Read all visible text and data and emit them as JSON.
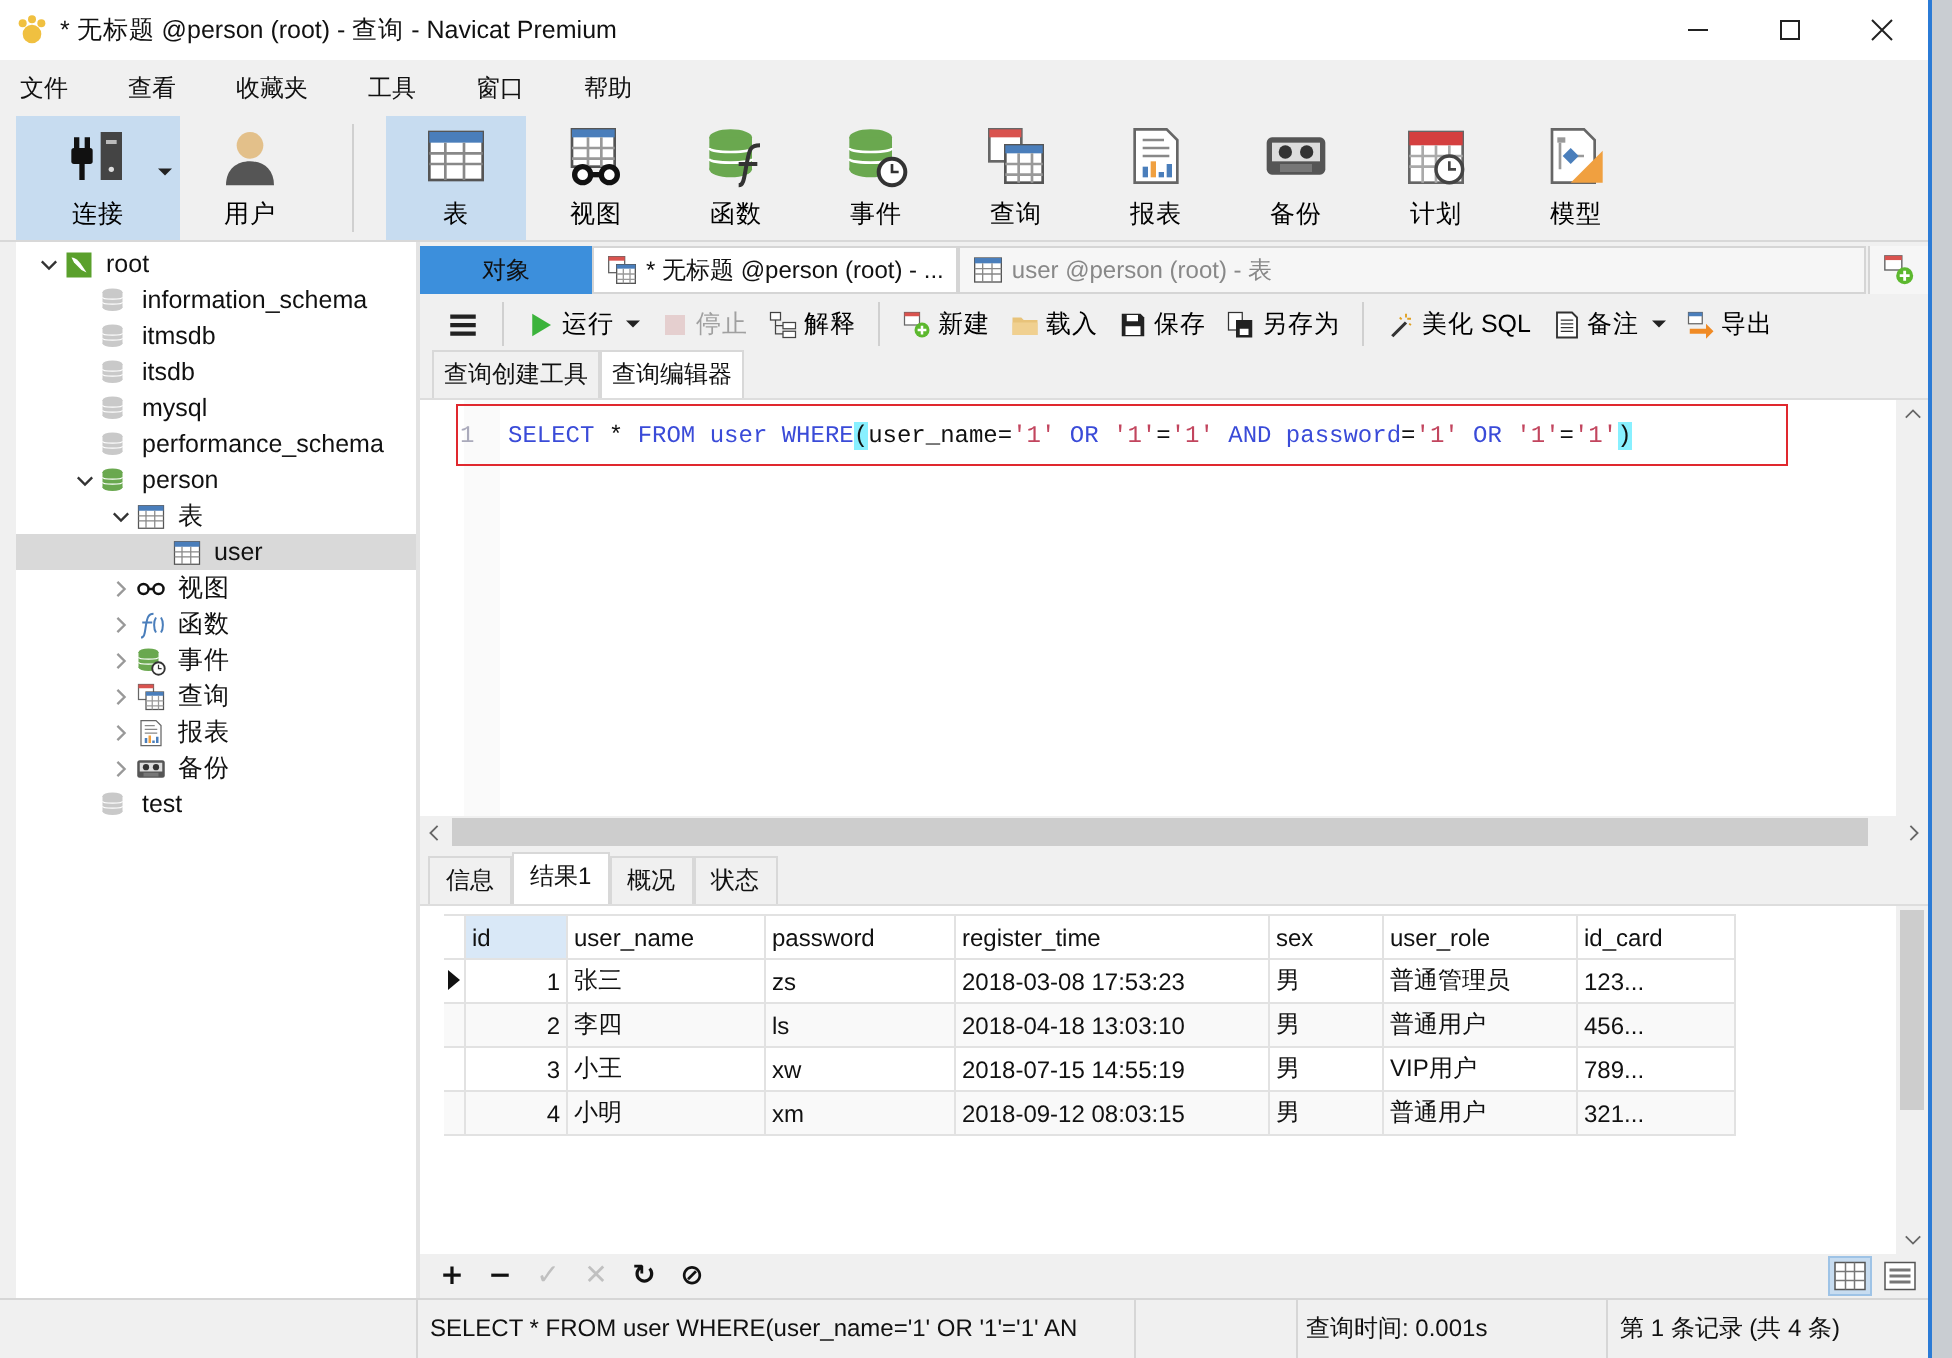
{
  "window": {
    "title": "* 无标题 @person (root) - 查询 - Navicat Premium"
  },
  "menu": [
    "文件",
    "查看",
    "收藏夹",
    "工具",
    "窗口",
    "帮助"
  ],
  "toolbar": [
    [
      {
        "label": "连接",
        "selected": true,
        "dropdown": true
      },
      {
        "label": "用户",
        "selected": false,
        "dropdown": false
      }
    ],
    [
      {
        "label": "表",
        "selected": true,
        "dropdown": false
      },
      {
        "label": "视图",
        "selected": false,
        "dropdown": false
      },
      {
        "label": "函数",
        "selected": false,
        "dropdown": false
      },
      {
        "label": "事件",
        "selected": false,
        "dropdown": false
      },
      {
        "label": "查询",
        "selected": false,
        "dropdown": false
      },
      {
        "label": "报表",
        "selected": false,
        "dropdown": false
      },
      {
        "label": "备份",
        "selected": false,
        "dropdown": false
      },
      {
        "label": "计划",
        "selected": false,
        "dropdown": false
      },
      {
        "label": "模型",
        "selected": false,
        "dropdown": false
      }
    ]
  ],
  "tree": [
    {
      "label": "root",
      "kind": "server",
      "expanded": true,
      "selected": false,
      "children": [
        {
          "label": "information_schema",
          "kind": "database",
          "selected": false
        },
        {
          "label": "itmsdb",
          "kind": "database",
          "selected": false
        },
        {
          "label": "itsdb",
          "kind": "database",
          "selected": false
        },
        {
          "label": "mysql",
          "kind": "database",
          "selected": false
        },
        {
          "label": "performance_schema",
          "kind": "database",
          "selected": false
        },
        {
          "label": "person",
          "kind": "database",
          "expanded": true,
          "selected": false,
          "children": [
            {
              "label": "表",
              "kind": "tables",
              "expanded": true,
              "selected": false,
              "children": [
                {
                  "label": "user",
                  "kind": "table",
                  "selected": true
                }
              ]
            },
            {
              "label": "视图",
              "kind": "views",
              "expanded": false,
              "selected": false
            },
            {
              "label": "函数",
              "kind": "functions",
              "expanded": false,
              "selected": false
            },
            {
              "label": "事件",
              "kind": "events",
              "expanded": false,
              "selected": false
            },
            {
              "label": "查询",
              "kind": "queries",
              "expanded": false,
              "selected": false
            },
            {
              "label": "报表",
              "kind": "reports",
              "expanded": false,
              "selected": false
            },
            {
              "label": "备份",
              "kind": "backups",
              "expanded": false,
              "selected": false
            }
          ]
        },
        {
          "label": "test",
          "kind": "database",
          "selected": false
        }
      ]
    }
  ],
  "editor_tabs": [
    {
      "label": "对象",
      "kind": "object",
      "selected": false
    },
    {
      "label": "* 无标题 @person (root) - ...",
      "kind": "query",
      "selected": true
    },
    {
      "label": "user @person (root) - 表",
      "kind": "table",
      "selected": false
    }
  ],
  "query_toolbar": [
    [
      {
        "disabled": false,
        "dropdown": false
      }
    ],
    [
      {
        "label": "运行",
        "disabled": false,
        "dropdown": true
      },
      {
        "label": "停止",
        "disabled": true,
        "dropdown": false
      },
      {
        "label": "解释",
        "disabled": false,
        "dropdown": false
      }
    ],
    [
      {
        "label": "新建",
        "disabled": false,
        "dropdown": false
      },
      {
        "label": "载入",
        "disabled": false,
        "dropdown": false
      },
      {
        "label": "保存",
        "disabled": false,
        "dropdown": false
      },
      {
        "label": "另存为",
        "disabled": false,
        "dropdown": false
      }
    ],
    [
      {
        "label": "美化 SQL",
        "disabled": false,
        "dropdown": false
      },
      {
        "label": "备注",
        "disabled": false,
        "dropdown": true
      },
      {
        "label": "导出",
        "disabled": false,
        "dropdown": false
      }
    ]
  ],
  "sub_tabs": [
    {
      "label": "查询创建工具",
      "selected": false
    },
    {
      "label": "查询编辑器",
      "selected": true
    }
  ],
  "sql": {
    "line_number": "1",
    "tokens": [
      {
        "text": "SELECT",
        "kind": "keyword"
      },
      {
        "text": " * ",
        "kind": "plain"
      },
      {
        "text": "FROM user WHERE",
        "kind": "keyword"
      },
      {
        "text": "(",
        "kind": "bracket"
      },
      {
        "text": "user_name=",
        "kind": "plain"
      },
      {
        "text": "'1'",
        "kind": "string"
      },
      {
        "text": " OR",
        "kind": "keyword"
      },
      {
        "text": " '1'",
        "kind": "string"
      },
      {
        "text": "=",
        "kind": "plain"
      },
      {
        "text": "'1'",
        "kind": "string"
      },
      {
        "text": " AND password",
        "kind": "keyword"
      },
      {
        "text": "=",
        "kind": "plain"
      },
      {
        "text": "'1'",
        "kind": "string"
      },
      {
        "text": " OR",
        "kind": "keyword"
      },
      {
        "text": " '1'",
        "kind": "string"
      },
      {
        "text": "=",
        "kind": "plain"
      },
      {
        "text": "'1'",
        "kind": "string"
      },
      {
        "text": ")",
        "kind": "bracket"
      }
    ]
  },
  "result_tabs": [
    {
      "label": "信息",
      "selected": false
    },
    {
      "label": "结果1",
      "selected": true
    },
    {
      "label": "概况",
      "selected": false
    },
    {
      "label": "状态",
      "selected": false
    }
  ],
  "grid": {
    "columns": [
      {
        "label": "id",
        "selected": true
      },
      {
        "label": "user_name",
        "selected": false
      },
      {
        "label": "password",
        "selected": false
      },
      {
        "label": "register_time",
        "selected": false
      },
      {
        "label": "sex",
        "selected": false
      },
      {
        "label": "user_role",
        "selected": false
      },
      {
        "label": "id_card",
        "selected": false
      }
    ],
    "rows": [
      {
        "current": true,
        "cells": [
          "1",
          "张三",
          "zs",
          "2018-03-08 17:53:23",
          "男",
          "普通管理员",
          "123..."
        ]
      },
      {
        "current": false,
        "cells": [
          "2",
          "李四",
          "ls",
          "2018-04-18 13:03:10",
          "男",
          "普通用户",
          "456..."
        ]
      },
      {
        "current": false,
        "cells": [
          "3",
          "小王",
          "xw",
          "2018-07-15 14:55:19",
          "男",
          "VIP用户",
          "789..."
        ]
      },
      {
        "current": false,
        "cells": [
          "4",
          "小明",
          "xm",
          "2018-09-12 08:03:15",
          "男",
          "普通用户",
          "321..."
        ]
      }
    ]
  },
  "grid_tools": [
    {
      "symbol": "+",
      "disabled": false
    },
    {
      "symbol": "−",
      "disabled": false
    },
    {
      "symbol": "✓",
      "disabled": true
    },
    {
      "symbol": "✕",
      "disabled": true
    },
    {
      "symbol": "↻",
      "disabled": false
    },
    {
      "symbol": "⊘",
      "disabled": false
    }
  ],
  "views": [
    {
      "selected": true
    },
    {
      "selected": false
    }
  ],
  "status_bar": {
    "sql": "SELECT * FROM user WHERE(user_name='1' OR '1'='1' AN",
    "time": "查询时间: 0.001s",
    "record": "第 1 条记录 (共 4 条)"
  }
}
